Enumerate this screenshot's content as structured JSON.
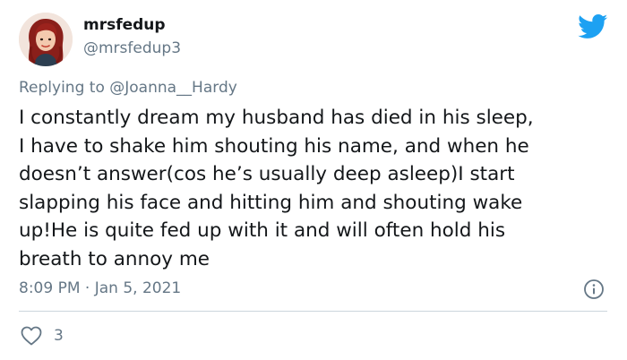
{
  "user": {
    "display_name": "mrsfedup",
    "handle": "@mrsfedup3"
  },
  "reply": {
    "prefix": "Replying to ",
    "mention": "@Joanna__Hardy"
  },
  "tweet": {
    "lines": [
      "I constantly dream my husband has died in his sleep,",
      "I have to shake him shouting his name, and when he",
      "doesn’t answer(cos he’s usually deep asleep)I start",
      "slapping his face and hitting him and shouting wake",
      "up!He is quite fed up with it and will often hold his",
      "breath to annoy me"
    ],
    "timestamp": "8:09 PM · Jan 5, 2021",
    "likes": "3"
  },
  "colors": {
    "twitter_blue": "#1da1f2",
    "secondary_text": "#657786",
    "divider": "#ccd6dd"
  },
  "icons": {
    "brand": "twitter-bird-icon",
    "info": "info-icon",
    "like": "heart-icon"
  }
}
